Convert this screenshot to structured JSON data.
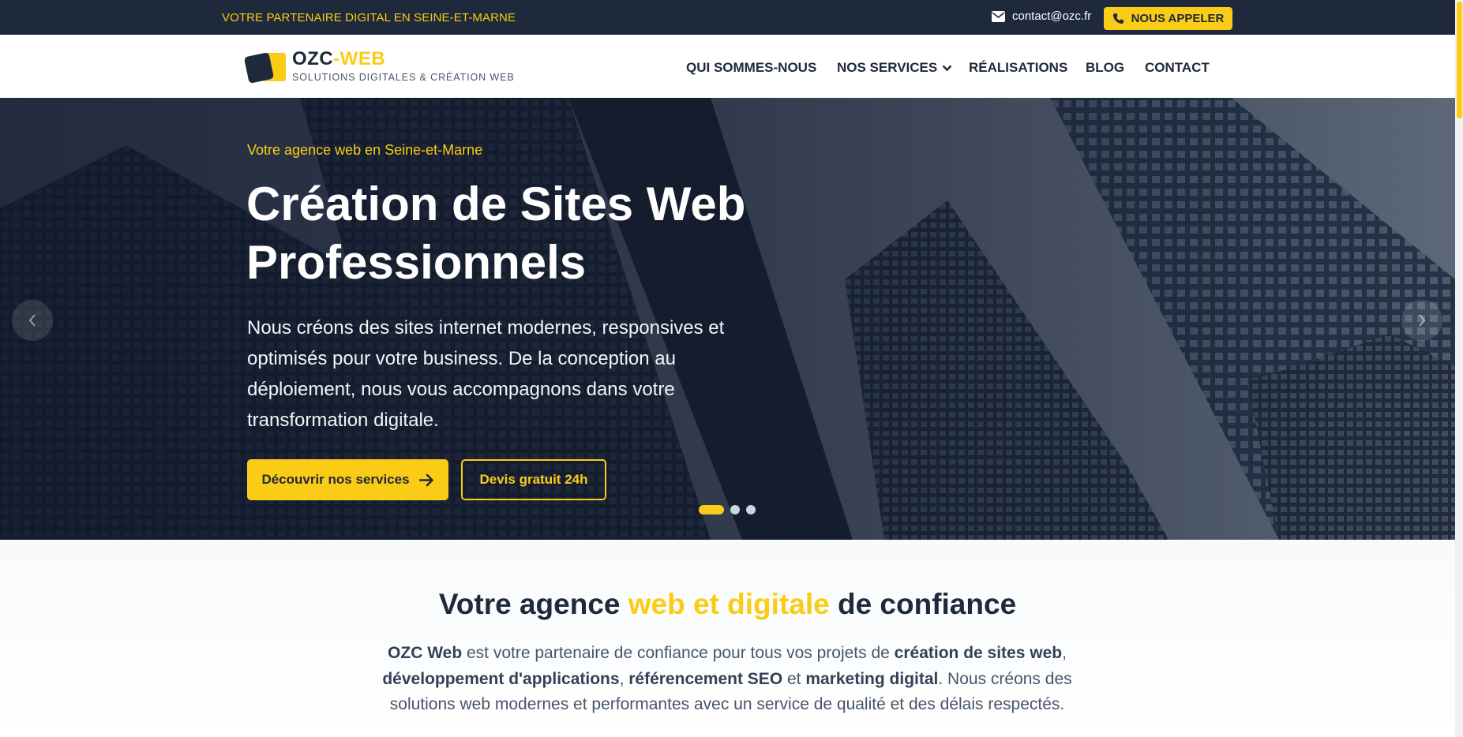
{
  "topbar": {
    "tagline": "VOTRE PARTENAIRE DIGITAL EN SEINE-ET-MARNE",
    "email": "contact@ozc.fr",
    "call_label": "NOUS APPELER"
  },
  "brand": {
    "name_main": "OZC",
    "name_accent": "-WEB",
    "subtitle": "SOLUTIONS DIGITALES & CRÉATION WEB"
  },
  "nav": {
    "items": [
      {
        "label": "QUI SOMMES-NOUS"
      },
      {
        "label": "NOS SERVICES"
      },
      {
        "label": "RÉALISATIONS"
      },
      {
        "label": "BLOG"
      },
      {
        "label": "CONTACT"
      }
    ]
  },
  "hero": {
    "eyebrow": "Votre agence web en Seine-et-Marne",
    "title_line1": "Création de Sites Web",
    "title_line2": "Professionnels",
    "text": "Nous créons des sites internet modernes, responsives et optimisés pour votre business. De la conception au déploiement, nous vous accompagnons dans votre transformation digitale.",
    "primary_button": "Découvrir nos services",
    "secondary_button": "Devis gratuit 24h",
    "active_slide": 1,
    "slide_count": 3
  },
  "intro": {
    "title_part1": "Votre agence ",
    "title_accent": "web et digitale",
    "title_part2": " de confiance",
    "p1": "OZC Web",
    "p2": " est votre partenaire de confiance pour tous vos projets de ",
    "p3": "création de sites web",
    "p4": ", ",
    "p5": "développement d'applications",
    "p6": ", ",
    "p7": "référencement SEO",
    "p8": " et ",
    "p9": "marketing digital",
    "p10": ". Nous créons des solutions web modernes et performantes avec un service de qualité et des délais respectés."
  },
  "colors": {
    "accent": "#facc15",
    "dark": "#1e293b"
  }
}
